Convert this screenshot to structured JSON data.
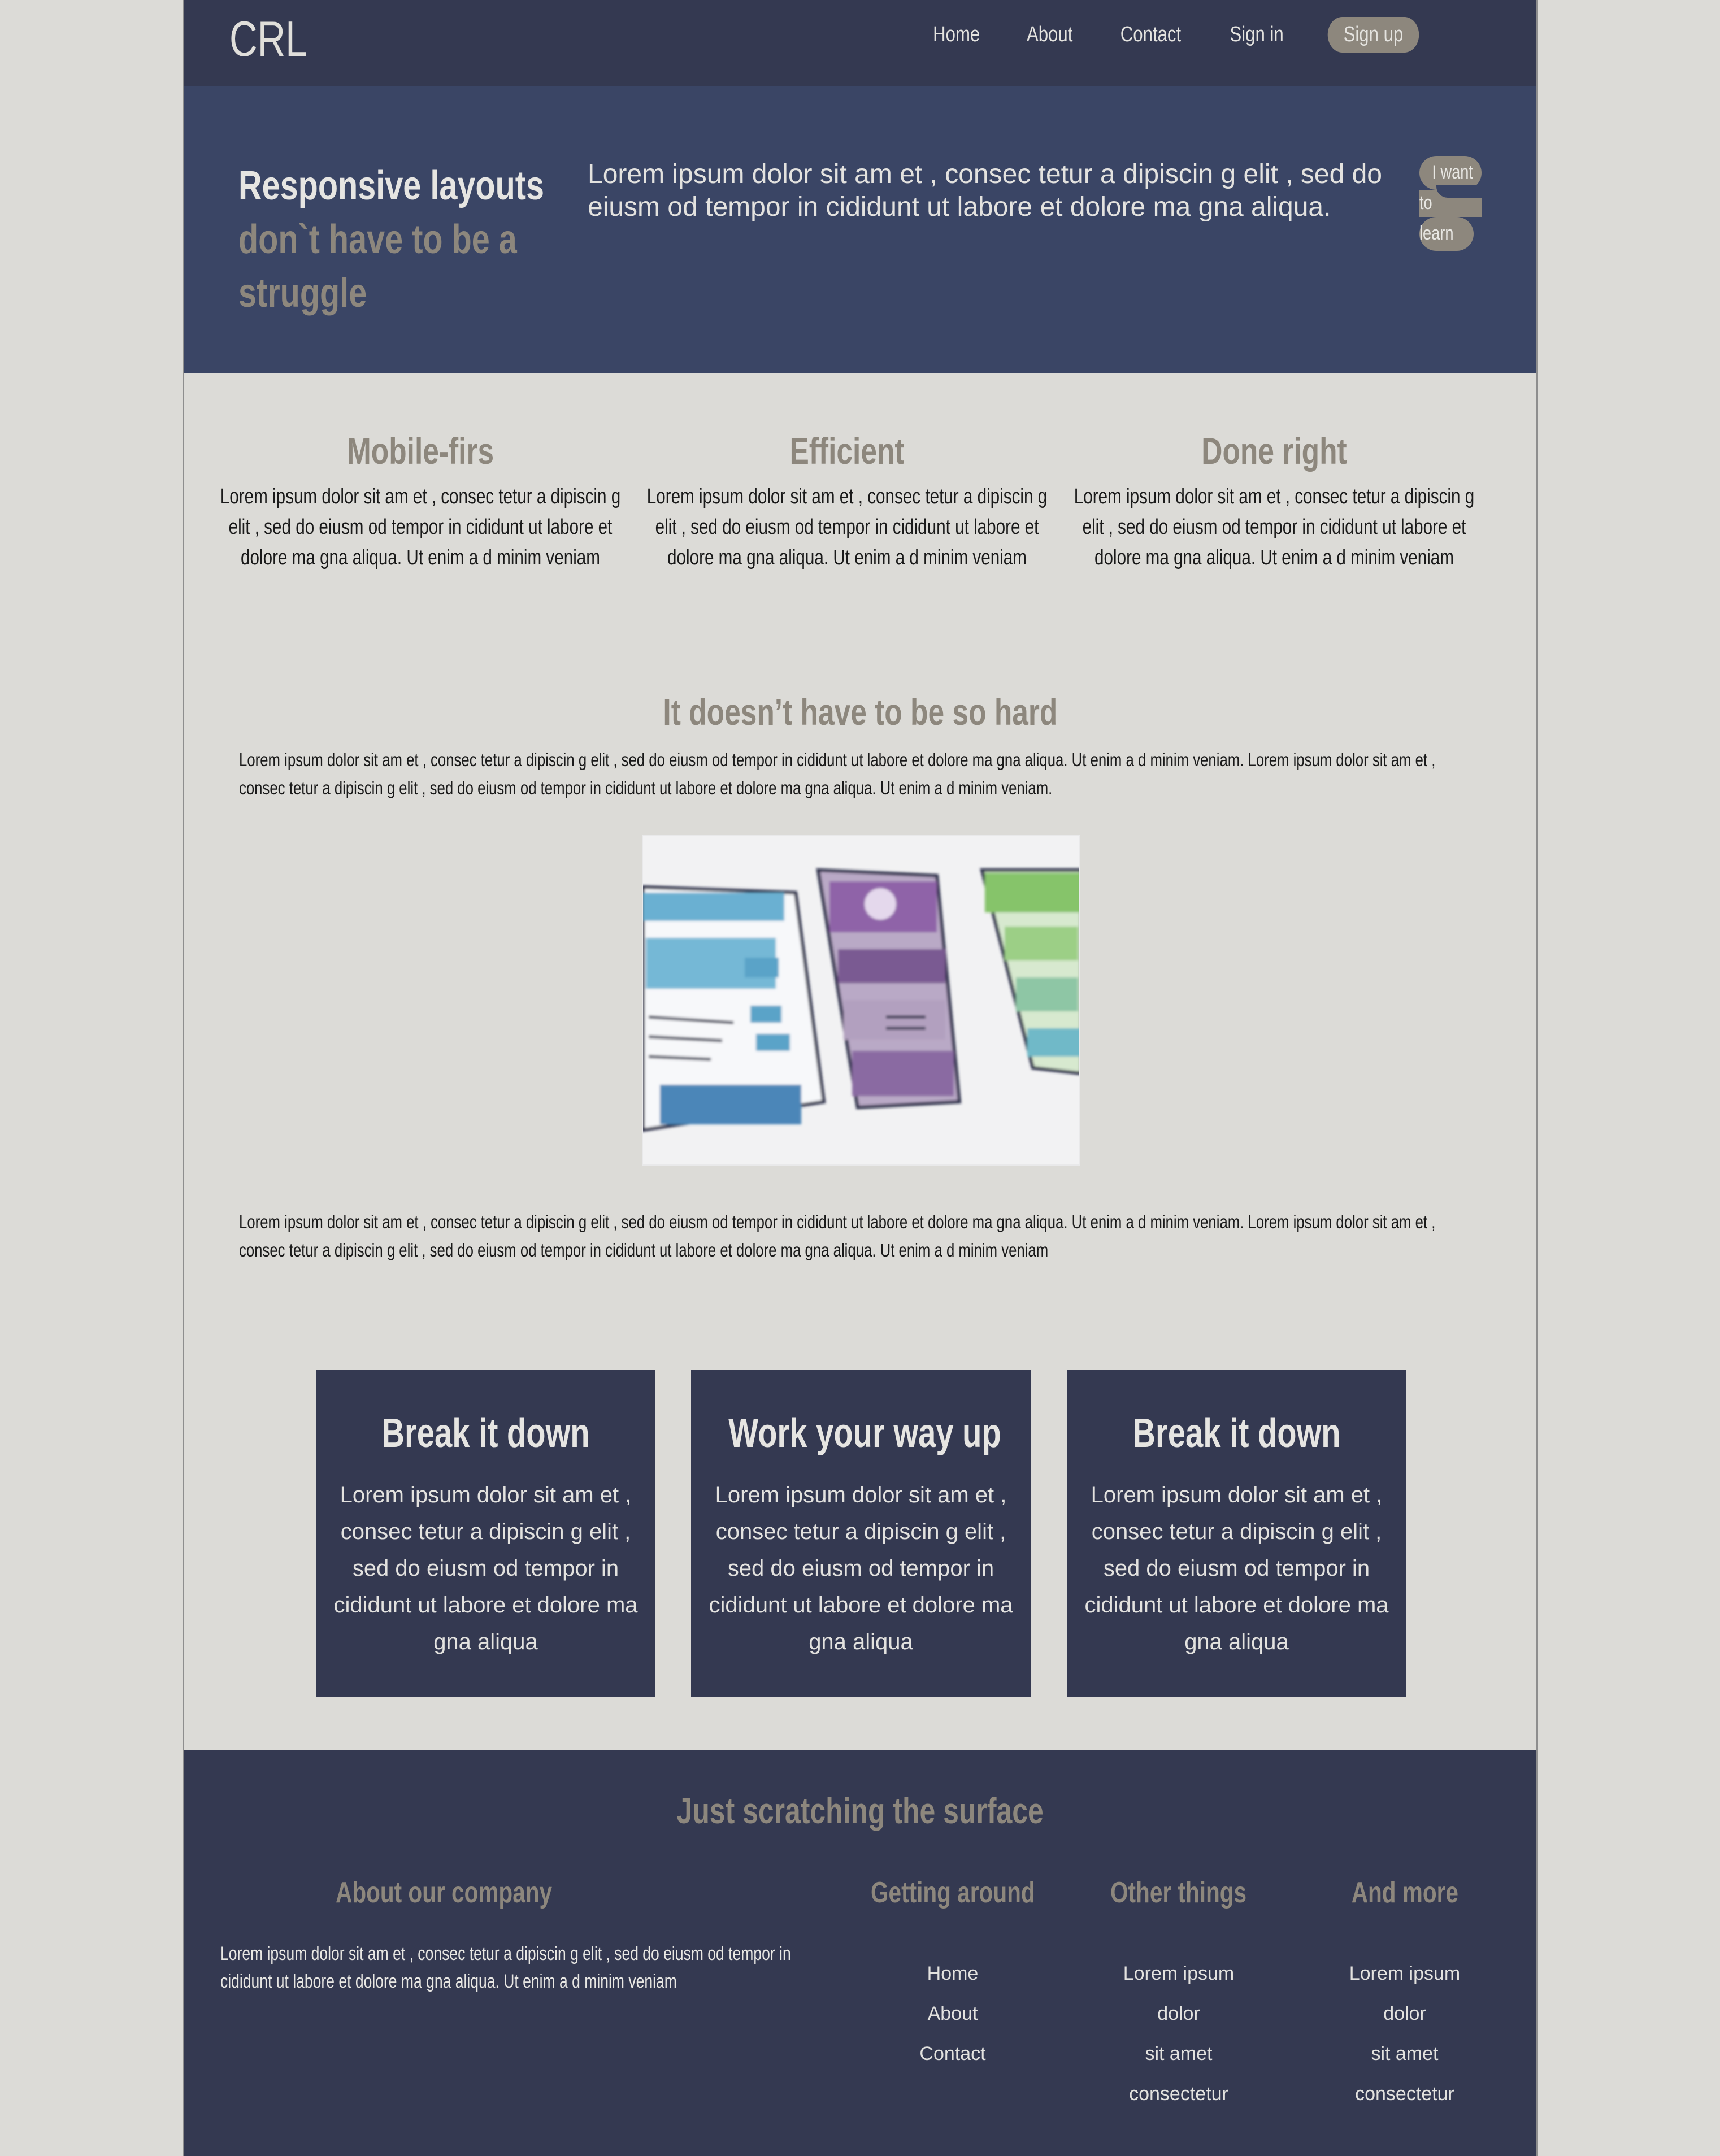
{
  "header": {
    "logo": "CRL",
    "nav": [
      {
        "label": "Home"
      },
      {
        "label": "About"
      },
      {
        "label": "Contact"
      },
      {
        "label": "Sign in"
      }
    ],
    "signup_label": "Sign up"
  },
  "hero": {
    "title_line1": "Responsive layouts",
    "title_line2": "don`t have to be a",
    "title_line3": "struggle",
    "text": "Lorem ipsum dolor sit am et , consec tetur a dipiscin g elit , sed do eiusm od tempor in cididunt ut labore et dolore ma gna aliqua.",
    "cta_line1": "I want",
    "cta_line2": "to",
    "cta_line3": "learn"
  },
  "features": [
    {
      "title": "Mobile-firs",
      "text": "Lorem ipsum dolor sit am et , consec tetur a dipiscin g elit , sed do eiusm od tempor in cididunt ut labore et dolore ma gna aliqua. Ut enim a d minim veniam"
    },
    {
      "title": "Efficient",
      "text": "Lorem ipsum dolor sit am et , consec tetur a dipiscin g elit , sed do eiusm od tempor in cididunt ut labore et dolore ma gna aliqua. Ut enim a d minim veniam"
    },
    {
      "title": "Done right",
      "text": "Lorem ipsum dolor sit am et , consec tetur a dipiscin g elit , sed do eiusm od tempor in cididunt ut labore et dolore ma gna aliqua. Ut enim a d minim veniam"
    }
  ],
  "section2": {
    "title": "It doesn’t have to be so hard",
    "para1": "Lorem ipsum dolor sit am et , consec tetur a dipiscin g elit , sed do eiusm od tempor in cididunt ut labore et dolore ma gna aliqua. Ut enim a d minim veniam. Lorem ipsum dolor sit am et , consec tetur a dipiscin g elit , sed do eiusm od tempor in cididunt ut labore et dolore ma gna aliqua. Ut enim a d minim veniam.",
    "para2": "Lorem ipsum dolor sit am et , consec tetur a dipiscin g elit , sed do eiusm od tempor in cididunt ut labore et dolore ma gna aliqua. Ut enim a d minim veniam. Lorem ipsum dolor sit am et , consec tetur a dipiscin g elit , sed do eiusm od tempor in cididunt ut labore et dolore ma gna aliqua. Ut enim a d minim veniam"
  },
  "cards": [
    {
      "title": "Break it down",
      "text": "Lorem ipsum dolor sit am et , consec tetur a dipiscin g elit , sed do eiusm od tempor in cididunt ut labore et dolore ma gna aliqua"
    },
    {
      "title": "Work your way up",
      "text": "Lorem ipsum dolor sit am et , consec tetur a dipiscin g elit , sed do eiusm od tempor in cididunt ut labore et dolore ma gna aliqua"
    },
    {
      "title": "Break it down",
      "text": "Lorem ipsum dolor sit am et , consec tetur a dipiscin g elit , sed do eiusm od tempor in cididunt ut labore et dolore ma gna aliqua"
    }
  ],
  "footer": {
    "title": "Just scratching the surface",
    "about_title": "About our company",
    "about_text": "Lorem ipsum dolor sit am et , consec tetur a dipiscin g elit , sed do eiusm od tempor in cididunt ut labore et dolore ma gna aliqua. Ut enim a d minim veniam",
    "getting_around_title": "Getting around",
    "getting_around": [
      "Home",
      "About",
      "Contact"
    ],
    "other_title": "Other things",
    "other": [
      "Lorem ipsum",
      "dolor",
      "sit amet",
      "consectetur"
    ],
    "more_title": "And more",
    "more": [
      "Lorem ipsum",
      "dolor",
      "sit amet",
      "consectetur"
    ]
  },
  "colors": {
    "page_bg": "#dcdbd7",
    "header_bg": "#343951",
    "hero_bg": "#3a4565",
    "accent": "#8d877d",
    "light_text": "#e3e2df"
  }
}
